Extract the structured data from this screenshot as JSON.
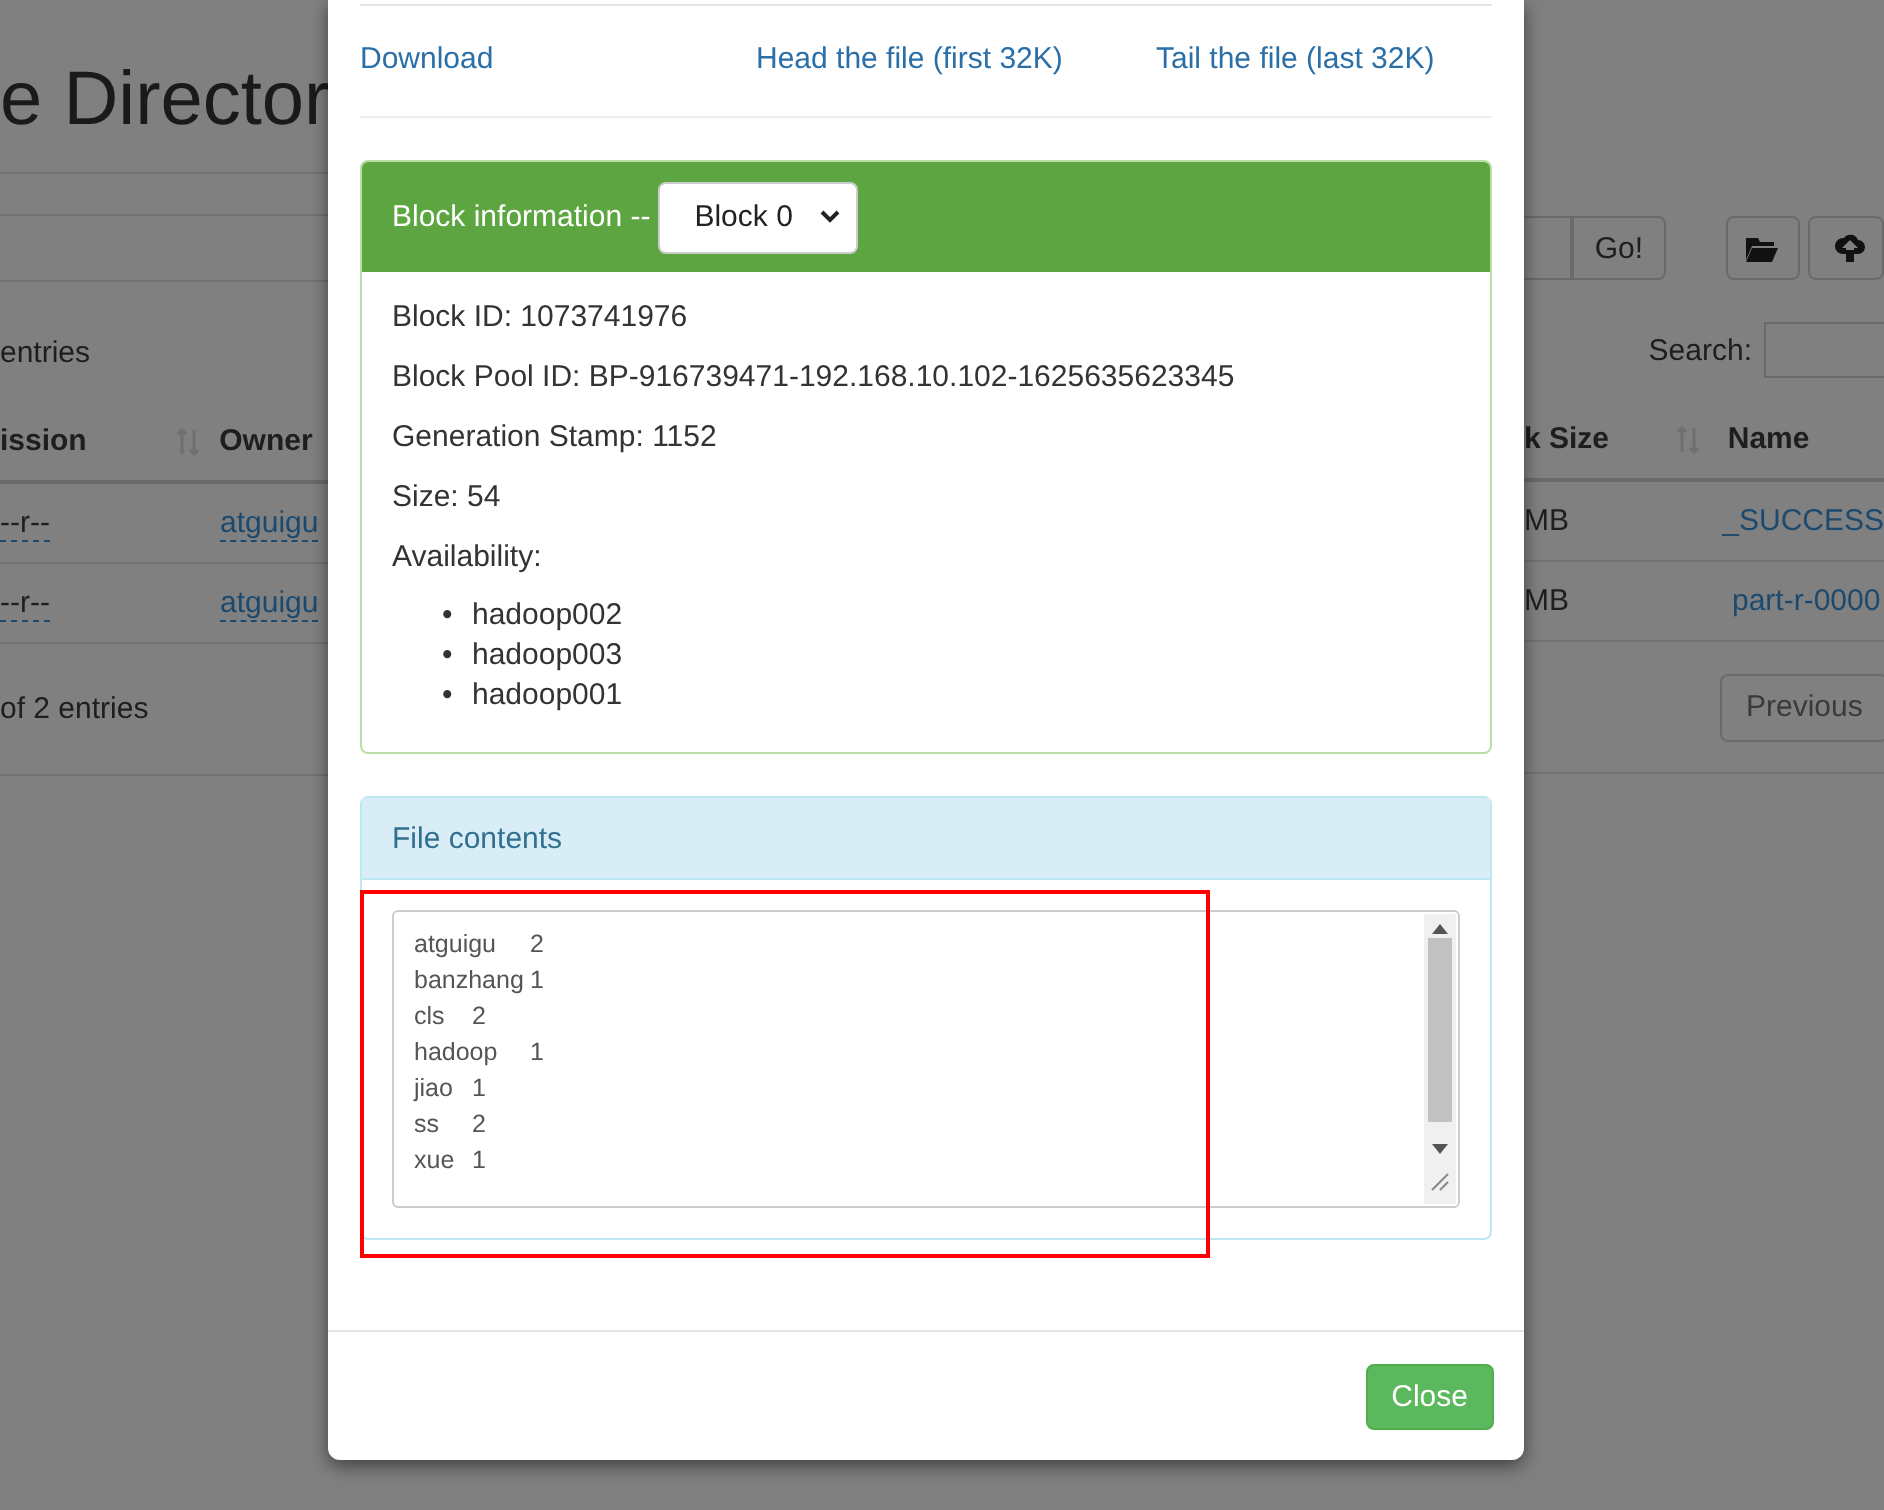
{
  "background_left": {
    "title": "e Director",
    "entries_label": "entries",
    "columns": [
      {
        "label": "ission",
        "sortable": true
      },
      {
        "label": "Owner",
        "sortable": false
      }
    ],
    "rows": [
      [
        "--r--",
        "atguigu"
      ],
      [
        "--r--",
        "atguigu"
      ]
    ],
    "footer": "of 2 entries"
  },
  "background_right": {
    "go_button": "Go!",
    "search_label": "Search:",
    "columns": [
      {
        "label": "k Size",
        "sortable": true
      },
      {
        "label": "Name",
        "sortable": false
      }
    ],
    "rows": [
      [
        "MB",
        "_SUCCESS"
      ],
      [
        "MB",
        "part-r-0000"
      ]
    ],
    "previous_button": "Previous"
  },
  "modal": {
    "links": [
      "Download",
      "Head the file (first 32K)",
      "Tail the file (last 32K)"
    ],
    "block_panel": {
      "title": "Block information --",
      "select": "Block 0",
      "fields": [
        "Block ID: 1073741976",
        "Block Pool ID: BP-916739471-192.168.10.102-1625635623345",
        "Generation Stamp: 1152",
        "Size: 54"
      ],
      "availability_label": "Availability:",
      "hosts": [
        {
          "bullet": "•",
          "name": "hadoop002"
        },
        {
          "bullet": "•",
          "name": "hadoop003"
        },
        {
          "bullet": "•",
          "name": "hadoop001"
        }
      ]
    },
    "contents_panel": {
      "title": "File contents",
      "lines": [
        "atguigu\t2",
        "banzhang\t1",
        "cls\t2",
        "hadoop\t1",
        "jiao\t1",
        "ss\t2",
        "xue\t1"
      ]
    },
    "close_button": "Close"
  }
}
